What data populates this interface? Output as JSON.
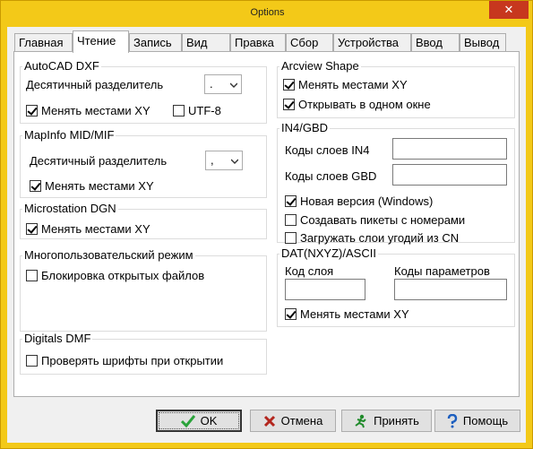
{
  "window": {
    "title": "Options",
    "close_glyph": "✕"
  },
  "tabs": [
    {
      "label": "Главная"
    },
    {
      "label": "Чтение"
    },
    {
      "label": "Запись"
    },
    {
      "label": "Вид"
    },
    {
      "label": "Правка"
    },
    {
      "label": "Сбор"
    },
    {
      "label": "Устройства"
    },
    {
      "label": "Ввод"
    },
    {
      "label": "Вывод"
    }
  ],
  "autocad": {
    "title": "AutoCAD DXF",
    "decimal_label": "Десятичный разделитель",
    "decimal_value": ".",
    "swap_xy": {
      "label": "Менять местами XY",
      "checked": true
    },
    "utf8": {
      "label": "UTF-8",
      "checked": false
    }
  },
  "mapinfo": {
    "title": "MapInfo MID/MIF",
    "decimal_label": "Десятичный разделитель",
    "decimal_value": ",",
    "swap_xy": {
      "label": "Менять местами XY",
      "checked": true
    }
  },
  "microstation": {
    "title": "Microstation DGN",
    "swap_xy": {
      "label": "Менять местами XY",
      "checked": true
    }
  },
  "multiuser": {
    "title": "Многопользовательский режим",
    "lock_files": {
      "label": "Блокировка открытых файлов",
      "checked": false
    }
  },
  "digitals": {
    "title": "Digitals DMF",
    "check_fonts": {
      "label": "Проверять шрифты при открытии",
      "checked": false
    }
  },
  "arcview": {
    "title": "Arcview Shape",
    "swap_xy": {
      "label": "Менять местами XY",
      "checked": true
    },
    "open_one": {
      "label": "Открывать в одном окне",
      "checked": true
    }
  },
  "in4": {
    "title": "IN4/GBD",
    "in4_codes_label": "Коды слоев IN4",
    "in4_codes_value": "",
    "gbd_codes_label": "Коды слоев GBD",
    "gbd_codes_value": "",
    "new_version": {
      "label": "Новая версия (Windows)",
      "checked": true
    },
    "create_pickets": {
      "label": "Создавать пикеты с номерами",
      "checked": false
    },
    "load_cn": {
      "label": "Загружать слои угодий из CN",
      "checked": false
    }
  },
  "dat": {
    "title": "DAT(NXYZ)/ASCII",
    "layer_code_label": "Код слоя",
    "layer_code_value": "",
    "param_codes_label": "Коды параметров",
    "param_codes_value": "",
    "swap_xy": {
      "label": "Менять местами XY",
      "checked": true
    }
  },
  "buttons": {
    "ok": "OK",
    "cancel": "Отмена",
    "apply": "Принять",
    "help": "Помощь"
  },
  "colors": {
    "frame": "#f3c918",
    "close": "#c7371e",
    "ok_icon": "#2aa33a",
    "cancel_icon": "#b3261e",
    "apply_icon": "#1f8a2a",
    "help_icon": "#1d5fbf"
  }
}
